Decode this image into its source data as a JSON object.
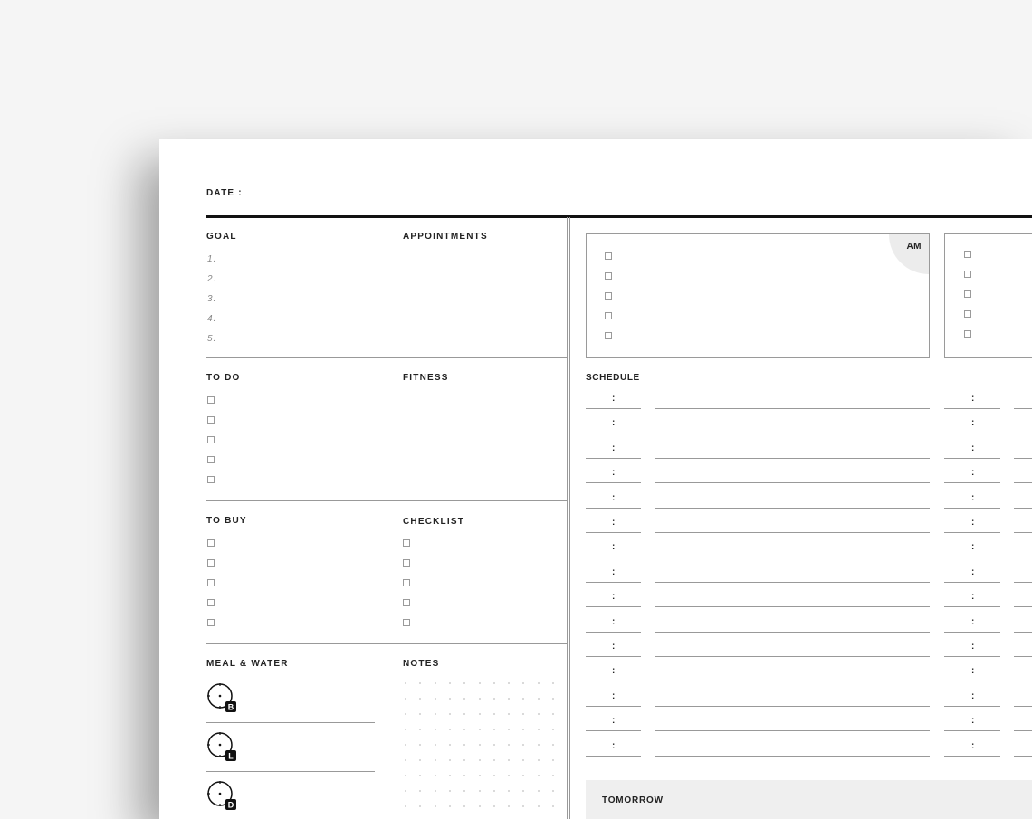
{
  "date_label": "DATE :",
  "goal": {
    "title": "GOAL",
    "numbers": [
      "1.",
      "2.",
      "3.",
      "4.",
      "5."
    ]
  },
  "appointments": {
    "title": "APPOINTMENTS"
  },
  "todo": {
    "title": "TO DO",
    "checkbox_count": 5
  },
  "fitness": {
    "title": "FITNESS"
  },
  "to_buy": {
    "title": "TO BUY",
    "checkbox_count": 5
  },
  "checklist": {
    "title": "CHECKLIST",
    "checkbox_count": 5
  },
  "meal_water": {
    "title": "MEAL & WATER",
    "meals": [
      "B",
      "L",
      "D"
    ]
  },
  "notes": {
    "title": "NOTES"
  },
  "am_panel": {
    "badge": "AM",
    "checkbox_count": 5
  },
  "schedule": {
    "title": "SCHEDULE",
    "slot_count": 15,
    "time_separator": ":"
  },
  "tomorrow": {
    "title": "TOMORROW"
  }
}
